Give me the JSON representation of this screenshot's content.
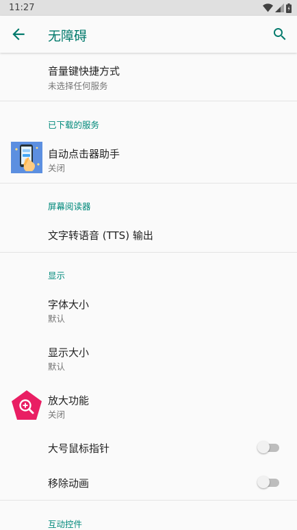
{
  "status_bar": {
    "time": "11:27"
  },
  "app_bar": {
    "title": "无障碍",
    "back_icon": "arrow-back-icon",
    "search_icon": "search-icon"
  },
  "items": {
    "volume_shortcut": {
      "title": "音量键快捷方式",
      "summary": "未选择任何服务"
    },
    "auto_clicker": {
      "title": "自动点击器助手",
      "summary": "关闭"
    },
    "tts": {
      "title": "文字转语音 (TTS) 输出"
    },
    "font_size": {
      "title": "字体大小",
      "summary": "默认"
    },
    "display_size": {
      "title": "显示大小",
      "summary": "默认"
    },
    "magnification": {
      "title": "放大功能",
      "summary": "关闭"
    },
    "large_pointer": {
      "title": "大号鼠标指针",
      "switch_on": false
    },
    "remove_animation": {
      "title": "移除动画",
      "switch_on": false
    }
  },
  "sections": {
    "downloaded": "已下载的服务",
    "screen_reader": "屏幕阅读器",
    "display": "显示",
    "interaction": "互动控件"
  },
  "colors": {
    "accent": "#00897b",
    "title_accent": "#00796b",
    "magnify_icon": "#e91e63"
  }
}
